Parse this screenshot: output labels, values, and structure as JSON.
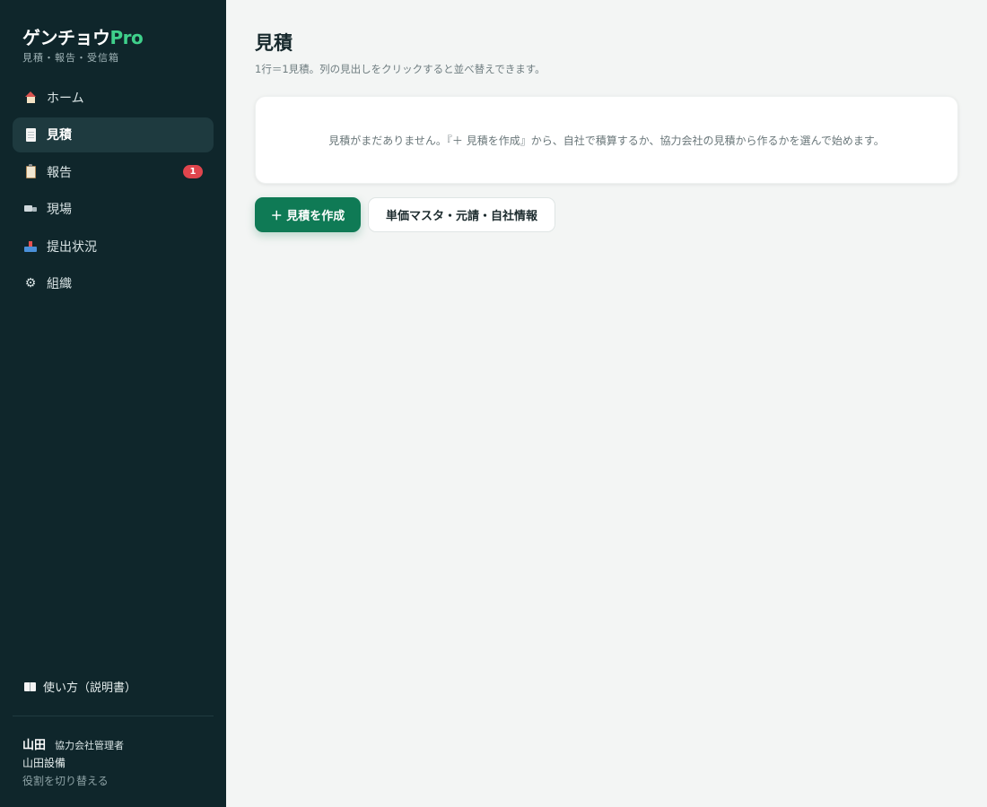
{
  "sidebar": {
    "brand": {
      "name": "ゲンチョウ",
      "suffix": "Pro",
      "subtitle": "見積・報告・受信箱"
    },
    "items": [
      {
        "label": "ホーム",
        "icon": "home-icon",
        "active": false
      },
      {
        "label": "見積",
        "icon": "document-icon",
        "active": true
      },
      {
        "label": "報告",
        "icon": "clipboard-icon",
        "active": false,
        "badge": "1"
      },
      {
        "label": "現場",
        "icon": "truck-icon",
        "active": false
      },
      {
        "label": "提出状況",
        "icon": "inbox-tray-icon",
        "active": false
      },
      {
        "label": "組織",
        "icon": "gear-icon",
        "active": false
      }
    ],
    "help": {
      "label": "使い方（説明書）",
      "icon": "book-icon"
    },
    "user": {
      "name": "山田",
      "role": "協力会社管理者",
      "company": "山田設備",
      "switch_label": "役割を切り替える"
    }
  },
  "main": {
    "title": "見積",
    "description": "1行＝1見積。列の見出しをクリックすると並べ替えできます。",
    "empty_message": "見積がまだありません。『＋ 見積を作成』から、自社で積算するか、協力会社の見積から作るかを選んで始めます。",
    "buttons": {
      "create": "＋ 見積を作成",
      "master": "単価マスタ・元請・自社情報"
    }
  },
  "colors": {
    "sidebar_bg": "#0f262b",
    "active_item_bg": "#1e3a3f",
    "brand_accent": "#3fd08b",
    "primary_button": "#0f7a55",
    "badge": "#e0454d",
    "page_bg": "#f3f5f4"
  }
}
